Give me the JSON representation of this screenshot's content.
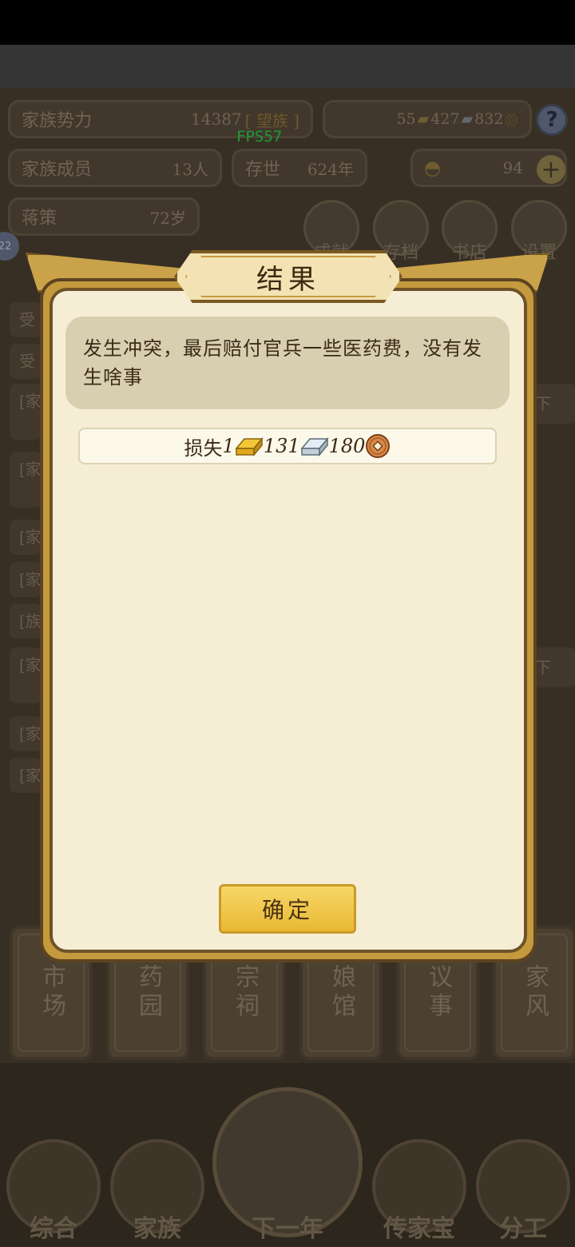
{
  "hud": {
    "power_label": "家族势力",
    "power_value": "14387",
    "power_rank": "[ 望族 ]",
    "fps": "FPS57",
    "gold": "55",
    "silver": "427",
    "coins": "832",
    "members_label": "家族成员",
    "members_value": "13人",
    "existence_label": "存世",
    "existence_value": "624年",
    "yuanbao": "94",
    "leader_label": "蒋策",
    "leader_age": "72岁",
    "round_buttons": [
      "成就",
      "存档",
      "书店",
      "设置"
    ],
    "level_badge": "22"
  },
  "background_rows": [
    "受",
    "受",
    "[家",
    "[家",
    "[家",
    "[家",
    "[族",
    "[家",
    "[家",
    "[家"
  ],
  "buildings": [
    "市场",
    "药园",
    "宗祠",
    "娘馆",
    "议事",
    "家风"
  ],
  "bottom_nav": [
    "综合",
    "家族",
    "下一年",
    "传家宝",
    "分工"
  ],
  "dialog": {
    "title": "结果",
    "message": "发生冲突，最后赔付官兵一些医药费，没有发生啥事",
    "loss": {
      "label": "损失",
      "gold": "1",
      "silver": "131",
      "coins": "180"
    },
    "confirm_label": "确定"
  },
  "colors": {
    "dialog_frame": "#c59a3e",
    "dialog_paper": "#f6eed4",
    "button_gold": "#f0c84a",
    "fps_green": "#28d94a"
  }
}
